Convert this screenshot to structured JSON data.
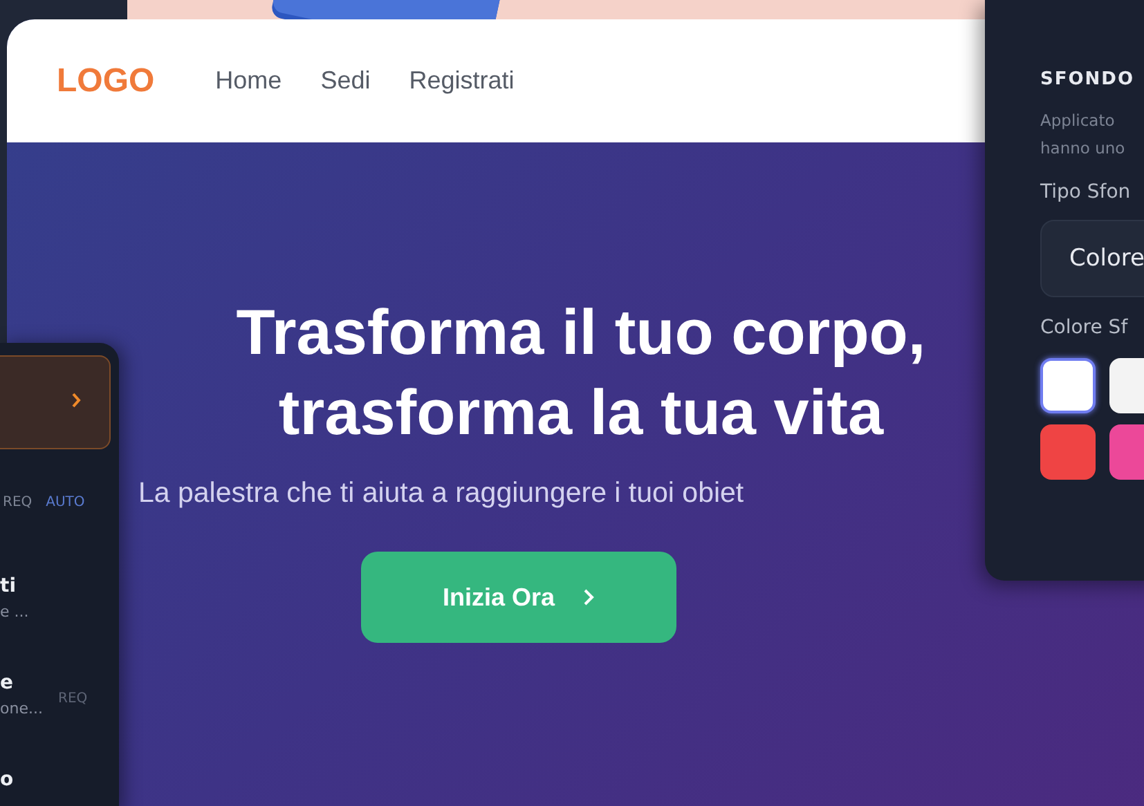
{
  "site": {
    "logo": "LOGO",
    "nav": [
      {
        "label": "Home"
      },
      {
        "label": "Sedi"
      },
      {
        "label": "Registrati"
      }
    ],
    "hero": {
      "title_lines": [
        "Trasforma il tuo corpo,",
        "trasforma la tua vita"
      ],
      "subtitle": "La palestra che ti aiuta a raggiungere i tuoi obiet",
      "cta": "Inizia Ora"
    }
  },
  "settings_panel": {
    "section": "SFONDO",
    "description_lines": [
      "Applicato",
      "hanno uno"
    ],
    "type_label": "Tipo Sfon",
    "type_value": "Colore",
    "color_label": "Colore Sf",
    "swatches": [
      {
        "color": "#ffffff",
        "selected": true
      },
      {
        "color": "#f3f3f3",
        "selected": false
      },
      {
        "color": "#ef4444",
        "selected": false
      },
      {
        "color": "#ec4899",
        "selected": false
      }
    ]
  },
  "side_panel": {
    "tags": [
      "REQ",
      "AUTO"
    ],
    "rows": [
      {
        "title": "ti",
        "subtitle": "e ...",
        "tag": ""
      },
      {
        "title": "e",
        "subtitle": "one...",
        "tag": "REQ"
      },
      {
        "title": "o",
        "subtitle": "",
        "tag": ""
      }
    ]
  }
}
